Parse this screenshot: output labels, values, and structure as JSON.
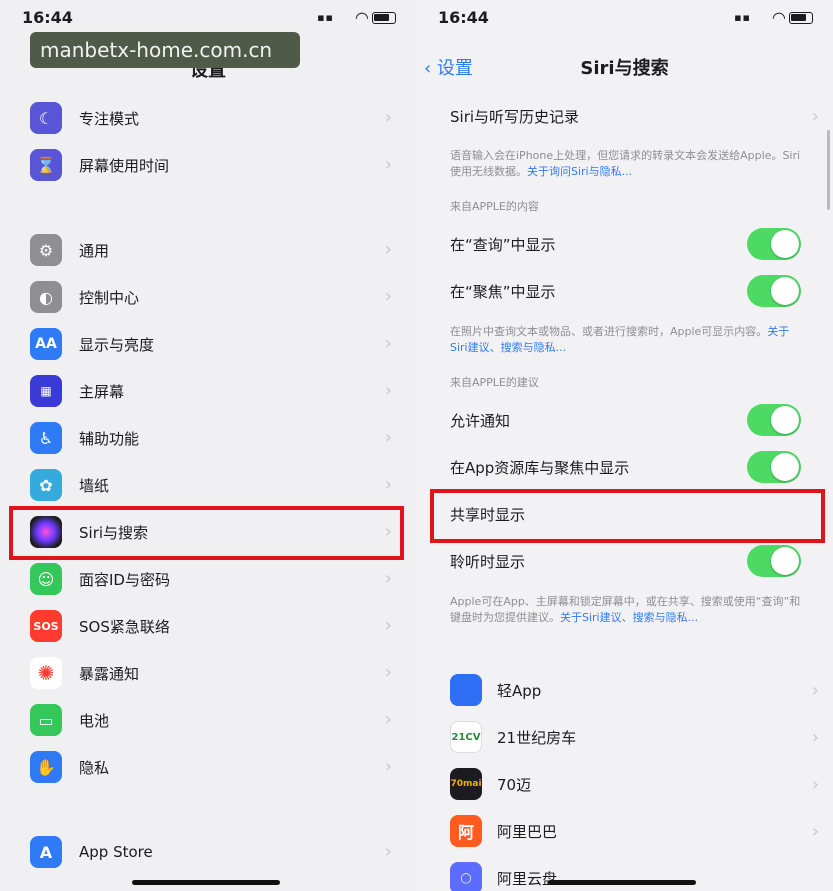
{
  "left": {
    "time": "16:44",
    "watermark": "manbetx-home.com.cn",
    "title": "设置",
    "items": [
      {
        "label": "专注模式",
        "icon": "moon-icon",
        "color": "#5856d6"
      },
      {
        "label": "屏幕使用时间",
        "icon": "hourglass-icon",
        "color": "#5856d6"
      },
      {
        "label": "通用",
        "icon": "gear-icon",
        "color": "#8e8e93"
      },
      {
        "label": "控制中心",
        "icon": "toggles-icon",
        "color": "#8e8e93"
      },
      {
        "label": "显示与亮度",
        "icon": "aa-icon",
        "color": "#2f7bf5"
      },
      {
        "label": "主屏幕",
        "icon": "grid-icon",
        "color": "#3a3ad6"
      },
      {
        "label": "辅助功能",
        "icon": "accessibility-icon",
        "color": "#2f7bf5"
      },
      {
        "label": "墙纸",
        "icon": "flower-icon",
        "color": "#35aadc"
      },
      {
        "label": "Siri与搜索",
        "icon": "siri-icon",
        "color": "#1c1c1e"
      },
      {
        "label": "面容ID与密码",
        "icon": "faceid-icon",
        "color": "#34c759"
      },
      {
        "label": "SOS紧急联络",
        "icon": "sos-icon",
        "color": "#ff3b30"
      },
      {
        "label": "暴露通知",
        "icon": "exposure-icon",
        "color": "#ffffff"
      },
      {
        "label": "电池",
        "icon": "battery-icon",
        "color": "#34c759"
      },
      {
        "label": "隐私",
        "icon": "hand-icon",
        "color": "#2f7bf5"
      },
      {
        "label": "App Store",
        "icon": "appstore-icon",
        "color": "#2f7bf5"
      }
    ],
    "aa_text": "AA",
    "sos_text": "SOS"
  },
  "right": {
    "time": "16:44",
    "back_label": "设置",
    "title": "Siri与搜索",
    "history_label": "Siri与听写历史记录",
    "note1": "语音输入会在iPhone上处理，但您请求的转录文本会发送给Apple。Siri使用无线数据。",
    "note1_link": "关于询问Siri与隐私...",
    "sec1": "来自APPLE的内容",
    "toggle_rows1": [
      {
        "label": "在“查询”中显示"
      },
      {
        "label": "在“聚焦”中显示"
      }
    ],
    "note2": "在照片中查询文本或物品、或者进行搜索时，Apple可显示内容。",
    "note2_link": "关于Siri建议、搜索与隐私...",
    "sec2": "来自APPLE的建议",
    "toggle_rows2": [
      {
        "label": "允许通知"
      },
      {
        "label": "在App资源库与聚焦中显示"
      }
    ],
    "share_label": "共享时显示",
    "listen_label": "聆听时显示",
    "note3": "Apple可在App、主屏幕和锁定屏幕中，或在共享、搜索或使用“查询”和键盘时为您提供建议。",
    "note3_link": "关于Siri建议、搜索与隐私...",
    "apps": [
      {
        "label": "轻App",
        "icon": "light-app-icon",
        "color": "#2f6ff5",
        "text": ""
      },
      {
        "label": "21世纪房车",
        "icon": "rv21-icon",
        "color": "#ffffff",
        "text": "21CV"
      },
      {
        "label": "70迈",
        "icon": "70mai-icon",
        "color": "#1c1c1e",
        "text": "70mai"
      },
      {
        "label": "阿里巴巴",
        "icon": "alibaba-icon",
        "color": "#ff5a1f",
        "text": "阿"
      },
      {
        "label": "阿里云盘",
        "icon": "aliyun-icon",
        "color": "#5b6cff",
        "text": ""
      }
    ]
  }
}
